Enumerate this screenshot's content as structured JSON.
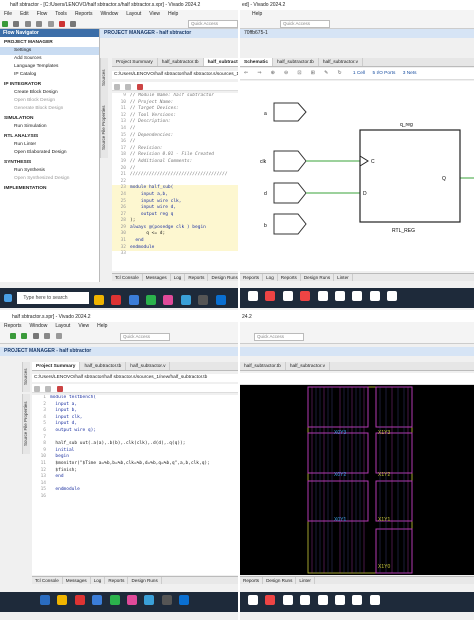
{
  "q1": {
    "title": "half sbtractor - [C:/Users/LENOVO/half sbtractor.s/half sbtractor.s.xpr] - Vivado 2024.2",
    "menu": [
      "File",
      "Edit",
      "Flow",
      "Tools",
      "Reports",
      "Window",
      "Layout",
      "View",
      "Help"
    ],
    "search_placeholder": "Quick Access",
    "flow_nav_title": "Flow Navigator",
    "project_bar": "PROJECT MANAGER - half sbtractor",
    "nav_items": [
      {
        "label": "PROJECT MANAGER",
        "type": "sec"
      },
      {
        "label": "Settings",
        "type": "item"
      },
      {
        "label": "Add Sources",
        "type": "item"
      },
      {
        "label": "Language Templates",
        "type": "item"
      },
      {
        "label": "IP Catalog",
        "type": "item"
      },
      {
        "label": "IP INTEGRATOR",
        "type": "sec"
      },
      {
        "label": "Create Block Design",
        "type": "item"
      },
      {
        "label": "Open Block Design",
        "type": "dim"
      },
      {
        "label": "Generate Block Design",
        "type": "dim"
      },
      {
        "label": "SIMULATION",
        "type": "sec"
      },
      {
        "label": "Run Simulation",
        "type": "item"
      },
      {
        "label": "RTL ANALYSIS",
        "type": "sec"
      },
      {
        "label": "Run Linter",
        "type": "item"
      },
      {
        "label": "Open Elaborated Design",
        "type": "item"
      },
      {
        "label": "SYNTHESIS",
        "type": "sec"
      },
      {
        "label": "Run Synthesis",
        "type": "item"
      },
      {
        "label": "Open Synthesized Design",
        "type": "dim"
      },
      {
        "label": "IMPLEMENTATION",
        "type": "sec"
      }
    ],
    "tabs": [
      "Project Summary",
      "half_subtractor.tb",
      "half_subtractor.v"
    ],
    "file_path": "C:/Users/LENOVO/half sbtractor/half sbtractor.s/sources_1/new/half_subtractor.v",
    "code": [
      {
        "n": "9",
        "t": "// Module Name: half subtractor",
        "c": "cmt"
      },
      {
        "n": "10",
        "t": "// Project Name:",
        "c": "cmt"
      },
      {
        "n": "11",
        "t": "// Target Devices:",
        "c": "cmt"
      },
      {
        "n": "12",
        "t": "// Tool Versions:",
        "c": "cmt"
      },
      {
        "n": "13",
        "t": "// Description:",
        "c": "cmt"
      },
      {
        "n": "14",
        "t": "//",
        "c": "cmt"
      },
      {
        "n": "15",
        "t": "// Dependencies:",
        "c": "cmt"
      },
      {
        "n": "16",
        "t": "//",
        "c": "cmt"
      },
      {
        "n": "17",
        "t": "// Revision:",
        "c": "cmt"
      },
      {
        "n": "18",
        "t": "// Revision 0.01 - File Created",
        "c": "cmt"
      },
      {
        "n": "19",
        "t": "// Additional Comments:",
        "c": "cmt"
      },
      {
        "n": "20",
        "t": "//",
        "c": "cmt"
      },
      {
        "n": "21",
        "t": "////////////////////////////////////",
        "c": "cmt"
      },
      {
        "n": "22",
        "t": "",
        "c": ""
      },
      {
        "n": "23",
        "t": "module half_sub(",
        "c": "kw"
      },
      {
        "n": "24",
        "t": "    input a,b,",
        "c": "kw"
      },
      {
        "n": "25",
        "t": "    input wire clk,",
        "c": "kw"
      },
      {
        "n": "26",
        "t": "    input wire d,",
        "c": "kw"
      },
      {
        "n": "27",
        "t": "    output reg q",
        "c": "kw"
      },
      {
        "n": "28",
        "t": ");",
        "c": ""
      },
      {
        "n": "29",
        "t": "always @(posedge clk ) begin",
        "c": "kw"
      },
      {
        "n": "30",
        "t": "      q <= d;",
        "c": ""
      },
      {
        "n": "31",
        "t": "  end",
        "c": "kw"
      },
      {
        "n": "32",
        "t": "endmodule",
        "c": "kw"
      },
      {
        "n": "33",
        "t": "",
        "c": ""
      }
    ],
    "bottom_tabs": [
      "Tcl Console",
      "Messages",
      "Log",
      "Reports",
      "Design Runs"
    ],
    "taskbar_search": "Type here to search"
  },
  "q2": {
    "title": "ed] - Vivado 2024.2",
    "menu": [
      "Help"
    ],
    "search_placeholder": "Quick Access",
    "bar": "70ffb675-1",
    "tabs": [
      "Schematic",
      "half_subtractor.tb",
      "half_subtractor.v"
    ],
    "stats": [
      "1 Cell",
      "5 I/O Ports",
      "3 Nets"
    ],
    "ports": [
      "a",
      "clk",
      "d",
      "b"
    ],
    "reg_name": "q_reg",
    "reg_type": "RTL_REG",
    "pin_c": "C",
    "pin_d": "D",
    "pin_q": "Q",
    "bottom_tabs": [
      "Reports",
      "Log",
      "Reports",
      "Design Runs",
      "Linter"
    ]
  },
  "q3": {
    "title": "half sbtractor.s.xpr] - Vivado 2024.2",
    "menu": [
      "Reports",
      "Window",
      "Layout",
      "View",
      "Help"
    ],
    "search_placeholder": "Quick Access",
    "project_bar": "PROJECT MANAGER - half sbtractor",
    "tabs": [
      "Project Summary",
      "half_subtractor.tb",
      "half_subtractor.v"
    ],
    "vtabs": [
      "Sources",
      "Source File Properties"
    ],
    "file_path": "C:/Users/LENOVO/half sbtractor/half sbtractor.s/sources_1/new/half_subtractor.tb",
    "code": [
      {
        "n": "1",
        "t": "module testbench(",
        "c": "kw"
      },
      {
        "n": "2",
        "t": "  input a,",
        "c": "kw"
      },
      {
        "n": "3",
        "t": "  input b,",
        "c": "kw"
      },
      {
        "n": "4",
        "t": "  input clk,",
        "c": "kw"
      },
      {
        "n": "5",
        "t": "  input d,",
        "c": "kw"
      },
      {
        "n": "6",
        "t": "  output wire q);",
        "c": "kw"
      },
      {
        "n": "7",
        "t": "",
        "c": ""
      },
      {
        "n": "8",
        "t": "  half_sub uut(.a(a),.b(b),.clk(clk),.d(d),.q(q));",
        "c": ""
      },
      {
        "n": "9",
        "t": "  initial",
        "c": "kw"
      },
      {
        "n": "10",
        "t": "  begin",
        "c": "kw"
      },
      {
        "n": "11",
        "t": "  $monitor(\"$Time a=%b,b=%b,clk=%b,d=%b,q=%b,q\",a,b,clk,q);",
        "c": ""
      },
      {
        "n": "12",
        "t": "  $finish;",
        "c": ""
      },
      {
        "n": "13",
        "t": "  end",
        "c": "kw"
      },
      {
        "n": "14",
        "t": "",
        "c": ""
      },
      {
        "n": "15",
        "t": "  endmodule",
        "c": "kw"
      },
      {
        "n": "16",
        "t": "",
        "c": ""
      }
    ],
    "bottom_tabs": [
      "Tcl Console",
      "Messages",
      "Log",
      "Reports",
      "Design Runs"
    ]
  },
  "q4": {
    "title": "24.2",
    "search_placeholder": "Quick Access",
    "tabs": [
      "half_subtractor.tb",
      "half_subtractor.v"
    ],
    "labels": [
      "X0Y3",
      "X1Y3",
      "X0Y2",
      "X1Y2",
      "X0Y1",
      "X1Y1",
      "X1Y0"
    ],
    "bottom_tabs": [
      "Reports",
      "Design Runs",
      "Linter"
    ]
  },
  "colors": {
    "vivado_blue": "#3c6ea8",
    "net_green": "#3aa33a",
    "device_bg": "#000000",
    "grid_magenta": "#b23ab2",
    "grid_yellow": "#c8c83a"
  }
}
